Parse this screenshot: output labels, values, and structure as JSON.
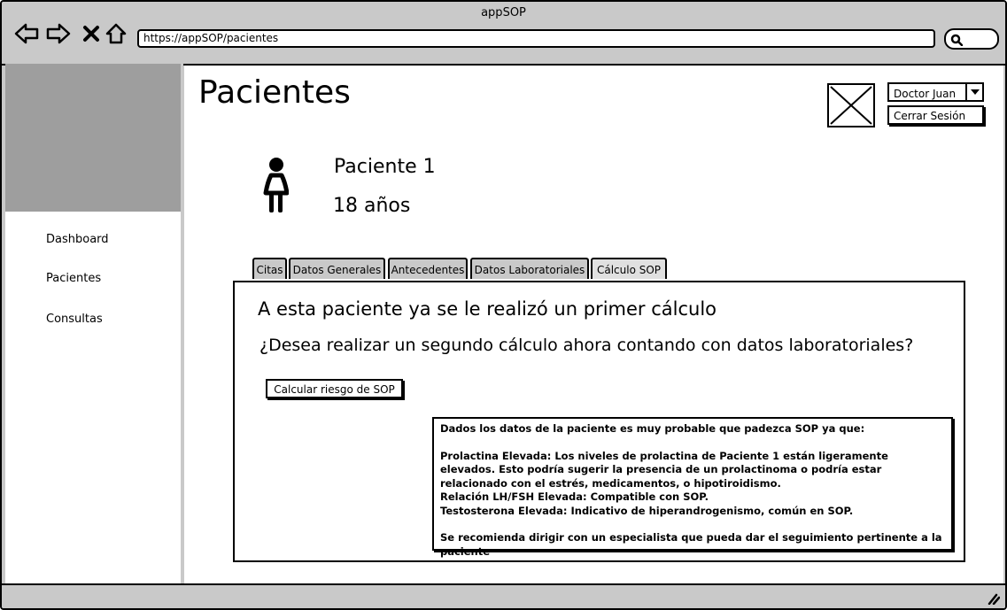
{
  "window": {
    "title": "appSOP"
  },
  "browser": {
    "url": "https://appSOP/pacientes"
  },
  "sidebar": {
    "items": [
      {
        "label": "Dashboard"
      },
      {
        "label": "Pacientes"
      },
      {
        "label": "Consultas"
      }
    ]
  },
  "header": {
    "title": "Pacientes",
    "user_name": "Doctor Juan",
    "logout_label": "Cerrar Sesión"
  },
  "patient": {
    "name": "Paciente 1",
    "age": "18 años"
  },
  "tabs": [
    {
      "label": "Citas"
    },
    {
      "label": "Datos Generales"
    },
    {
      "label": "Antecedentes"
    },
    {
      "label": "Datos Laboratoriales"
    },
    {
      "label": "Cálculo SOP",
      "active": true
    }
  ],
  "panel": {
    "heading": "A esta paciente ya se le realizó un primer cálculo",
    "question": "¿Desea realizar un segundo cálculo ahora contando con datos laboratoriales?",
    "button_label": "Calcular riesgo de SOP",
    "result": {
      "intro": "Dados los datos de la paciente es muy probable que padezca SOP ya que:",
      "lines": [
        "Prolactina Elevada: Los niveles de prolactina de Paciente 1 están ligeramente elevados. Esto podría sugerir la presencia de un prolactinoma o podría estar relacionado con el estrés, medicamentos, o hipotiroidismo.",
        "Relación LH/FSH Elevada: Compatible con SOP.",
        "Testosterona Elevada: Indicativo de hiperandrogenismo, común en SOP."
      ],
      "recommendation": "Se recomienda dirigir con un especialista que pueda dar el seguimiento pertinente a la paciente"
    }
  }
}
